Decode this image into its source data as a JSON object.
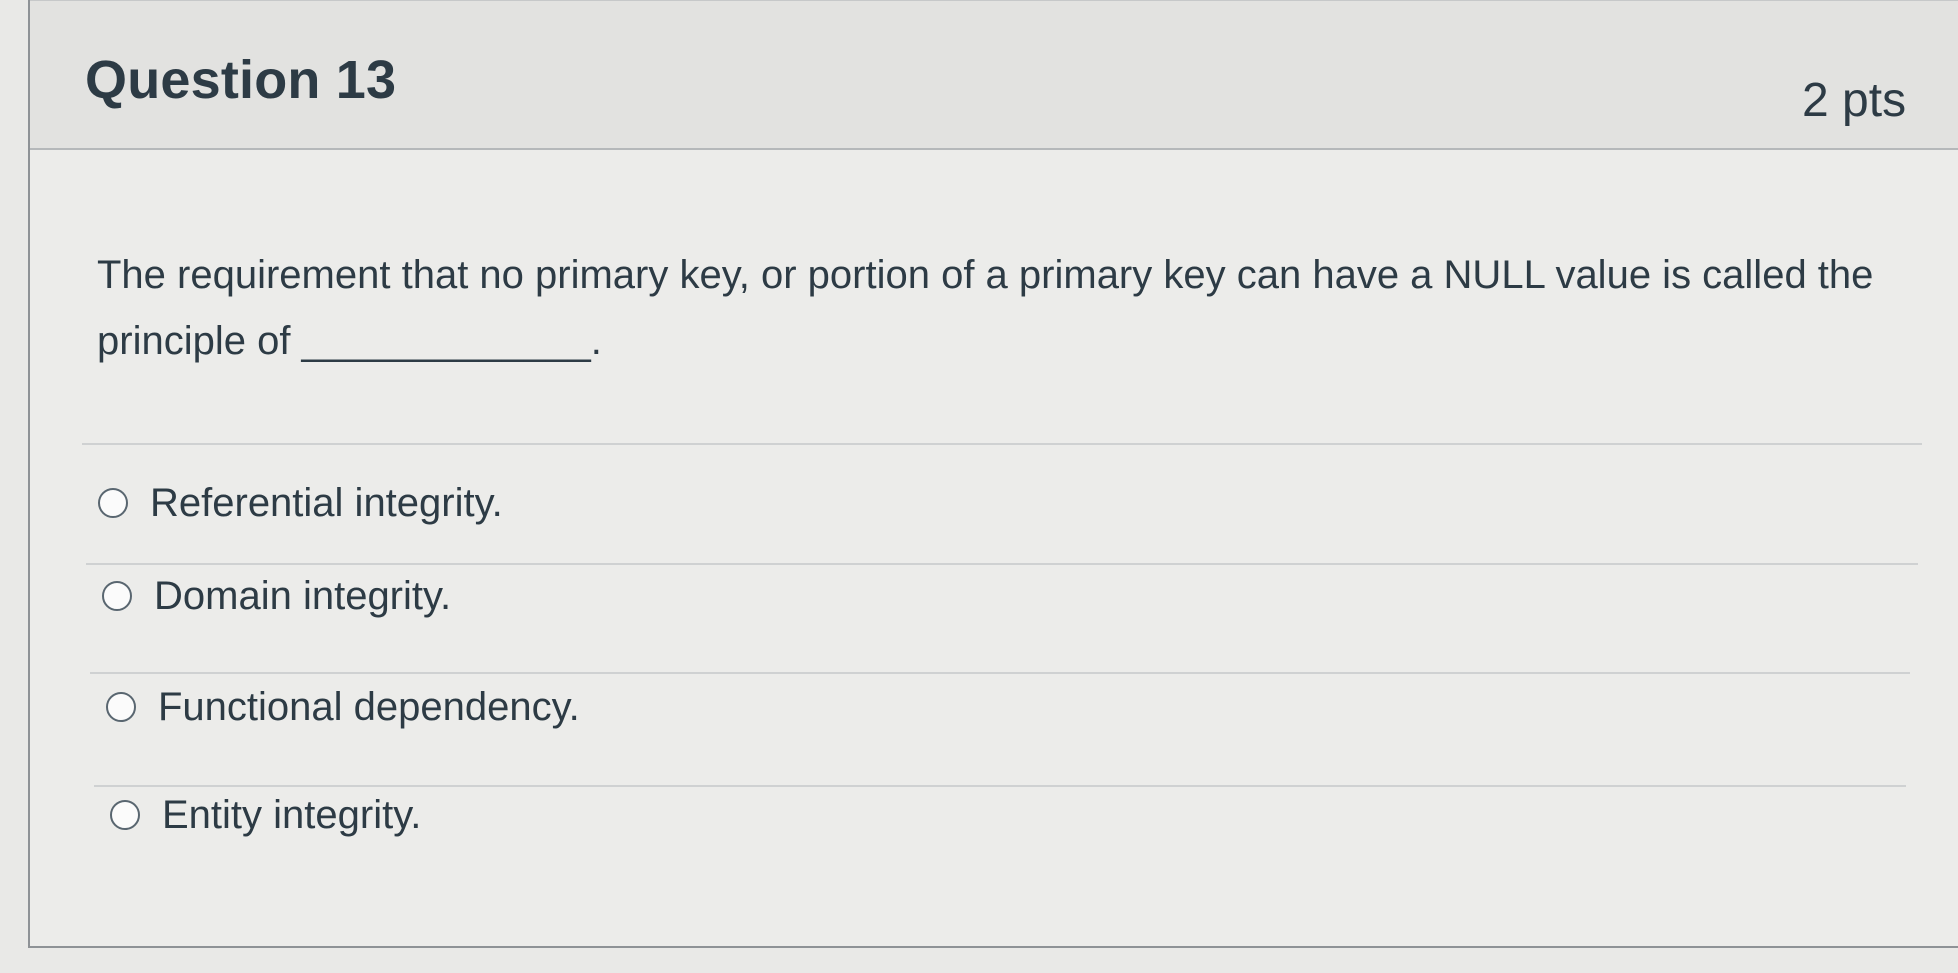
{
  "question": {
    "title": "Question 13",
    "points": "2 pts",
    "text": "The requirement that no primary key, or portion of a primary key can have a NULL value is called the principle of _____________."
  },
  "answers": [
    {
      "label": "Referential integrity.",
      "selected": false
    },
    {
      "label": "Domain integrity.",
      "selected": false
    },
    {
      "label": "Functional dependency.",
      "selected": false
    },
    {
      "label": "Entity integrity.",
      "selected": false
    }
  ]
}
